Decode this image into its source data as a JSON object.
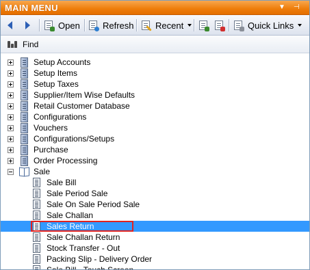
{
  "window": {
    "title": "MAIN MENU"
  },
  "toolbar": {
    "open_label": "Open",
    "refresh_label": "Refresh",
    "recent_label": "Recent",
    "quick_links_label": "Quick Links"
  },
  "find": {
    "label": "Find"
  },
  "tree": {
    "nodes": [
      {
        "label": "Setup Accounts",
        "expander": "plus"
      },
      {
        "label": "Setup Items",
        "expander": "plus"
      },
      {
        "label": "Setup Taxes",
        "expander": "plus"
      },
      {
        "label": "Supplier/Item Wise Defaults",
        "expander": "plus"
      },
      {
        "label": "Retail Customer Database",
        "expander": "plus"
      },
      {
        "label": "Configurations",
        "expander": "plus"
      },
      {
        "label": "Vouchers",
        "expander": "plus"
      },
      {
        "label": "Configurations/Setups",
        "expander": "plus"
      },
      {
        "label": "Purchase",
        "expander": "plus"
      },
      {
        "label": "Order Processing",
        "expander": "plus"
      },
      {
        "label": "Sale",
        "expander": "minus",
        "children": [
          {
            "label": "Sale Bill"
          },
          {
            "label": "Sale Period Sale"
          },
          {
            "label": "Sale On Sale Period Sale"
          },
          {
            "label": "Sale Challan"
          },
          {
            "label": "Sales Return",
            "selected": true
          },
          {
            "label": "Sale Challan Return"
          },
          {
            "label": "Stock Transfer - Out"
          },
          {
            "label": "Packing Slip - Delivery Order"
          },
          {
            "label": "Sale Bill - Touch Screen"
          }
        ]
      }
    ]
  },
  "colors": {
    "title_bar": "#ee7d0a",
    "selection": "#3399ff",
    "highlight_border": "#e0231f"
  }
}
